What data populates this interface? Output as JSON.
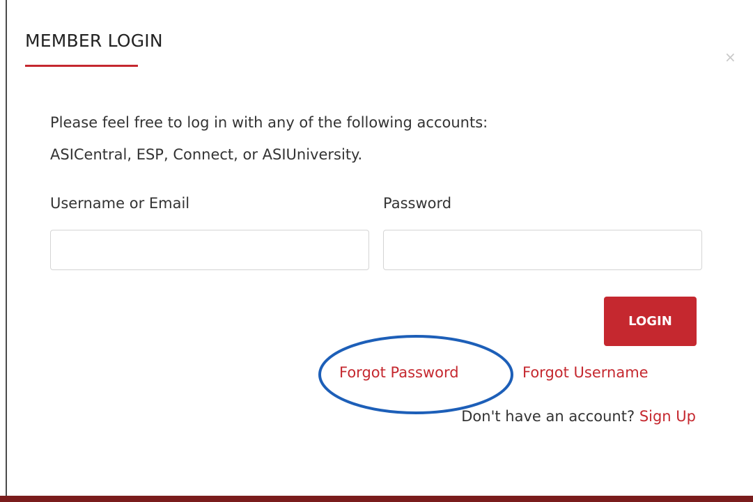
{
  "modal": {
    "title": "MEMBER LOGIN",
    "close_symbol": "×",
    "intro_line1": "Please feel free to log in with any of the following accounts:",
    "intro_line2": "ASICentral, ESP, Connect, or ASIUniversity."
  },
  "form": {
    "username_label": "Username or Email",
    "username_value": "",
    "password_label": "Password",
    "password_value": "",
    "login_label": "LOGIN"
  },
  "links": {
    "forgot_password": "Forgot Password",
    "forgot_username": "Forgot Username",
    "no_account_text": "Don't have an account?",
    "sign_up": "Sign Up"
  },
  "colors": {
    "accent": "#c5282f",
    "bottom_bar": "#7a1c1c",
    "annotation_circle": "#1d5fb8"
  },
  "icons": {
    "close": "close-icon"
  }
}
